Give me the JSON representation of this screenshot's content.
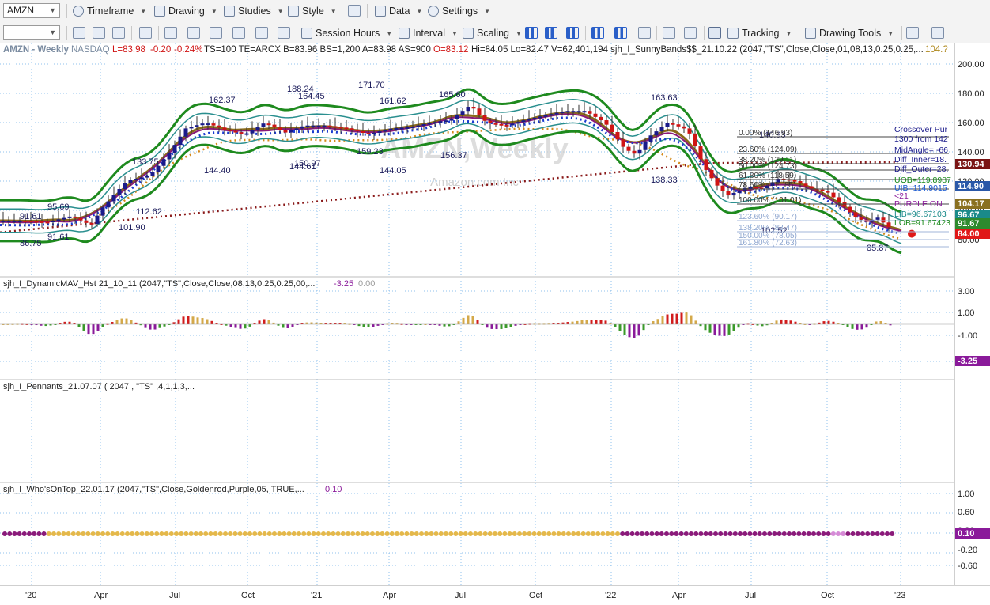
{
  "toolbar1": {
    "symbol": "AMZN",
    "timeframe": "Timeframe",
    "drawing": "Drawing",
    "studies": "Studies",
    "style": "Style",
    "data": "Data",
    "settings": "Settings"
  },
  "toolbar2": {
    "session_hours": "Session Hours",
    "interval": "Interval",
    "scaling": "Scaling",
    "tracking": "Tracking",
    "drawing_tools": "Drawing Tools"
  },
  "header": {
    "title": "AMZN - Weekly",
    "exchange": "NASDAQ",
    "last": "L=83.98",
    "chg": "-0.20",
    "pct": "-0.24%",
    "stats": "TS=100  TE=ARCX  B=83.96  BS=1,200  A=83.98  AS=900",
    "open": "O=83.12",
    "hilo": "Hi=84.05  Lo=82.47  V=62,401,194  sjh_I_SunnyBands$$_21.10.22 (2047,\"TS\",Close,Close,01,08,13,0.25,0.25,...",
    "last_val": "104.?"
  },
  "watermark": {
    "title": "AMZN,Weekly",
    "sub": "Amazon.com Inc"
  },
  "price_pane": {
    "y_ticks": [
      "200.00",
      "180.00",
      "160.00",
      "140.00",
      "120.00",
      "100.00",
      "80.00"
    ],
    "price_tags": [
      {
        "text": "130.94",
        "bg": "#7a1414"
      },
      {
        "text": "114.90",
        "bg": "#2a58a8"
      },
      {
        "text": "104.17",
        "bg": "#8a7020"
      },
      {
        "text": "96.67",
        "bg": "#1a8a8a"
      },
      {
        "text": "91.67",
        "bg": "#2e8a2e"
      },
      {
        "text": "84.00",
        "bg": "#e01818"
      }
    ],
    "labels": [
      "91.61",
      "86.75",
      "95.69",
      "133.75",
      "112.62",
      "101.90",
      "162.37",
      "144.40",
      "188.24",
      "164.45",
      "150.97",
      "144.61",
      "171.70",
      "161.62",
      "159.23",
      "144.05",
      "165.60",
      "156.37",
      "163.63",
      "138.33",
      "146.93",
      "102.52",
      "85.87",
      "91.61"
    ],
    "right_text": [
      "Crossover Pur",
      "1300 from 142",
      "MidAngle= -66",
      "Diff_Inner=18.",
      "Diff_Outer=28.",
      "UOB=119.8987",
      "UIB=114.9015",
      "<21",
      "PURPLE ON",
      "LIB=96.67103",
      "LOB=91.67423"
    ],
    "fib_levels": [
      "0.00% (146.93)",
      "23.60% (124.09)",
      "38.20% (129.11)",
      "50.00% (124.73)",
      "61.80% (118.59)",
      "78.60% (111.85)",
      "100.00% (101.01)",
      "123.60% (90.17)",
      "138.20% (83.47)",
      "150.00% (78.05)",
      "161.80% (72.63)"
    ]
  },
  "pane2": {
    "title": "sjh_I_DynamicMAV_Hst 21_10_11 (2047,\"TS\",Close,Close,08,13,0.25,0.25,00,...",
    "value": "-3.25",
    "value2": "0.00",
    "y_ticks": [
      "3.00",
      "1.00",
      "-1.00"
    ],
    "tag": "-3.25"
  },
  "pane3": {
    "title": "sjh_I_Pennants_21.07.07 ( 2047 , \"TS\" ,4,1,1,3,..."
  },
  "pane4": {
    "title": "sjh_I_Who'sOnTop_22.01.17 (2047,\"TS\",Close,Goldenrod,Purple,05, TRUE,...",
    "value": "0.10",
    "y_ticks": [
      "1.00",
      "0.60",
      "0.20",
      "-0.20",
      "-0.60"
    ],
    "tag": "0.10"
  },
  "x_labels": [
    "'20",
    "Apr",
    "Jul",
    "Oct",
    "'21",
    "Apr",
    "Jul",
    "Oct",
    "'22",
    "Apr",
    "Jul",
    "Oct",
    "'23"
  ],
  "colors": {
    "up": "#1a1a8a",
    "down": "#d01414",
    "band": "#1e8a1e",
    "inner": "#2a8f8f",
    "mav": "#8a6a1a",
    "hist_up": "#d4a94a",
    "hist_red": "#d21c1c",
    "hist_green": "#3a9a2a",
    "hist_purple": "#8a1a9a",
    "gold": "#e4b84a",
    "purple": "#8a1a7a"
  }
}
